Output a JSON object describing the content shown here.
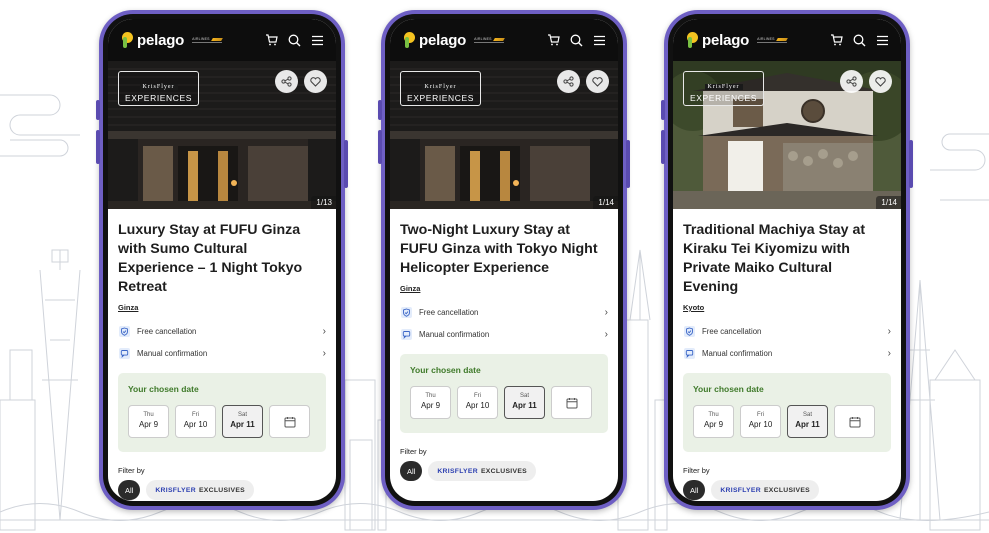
{
  "brand": {
    "name": "pelago",
    "airline_text": "AIRLINES",
    "experiences_small": "KrisFlyer",
    "experiences_big": "EXPERIENCES"
  },
  "colors": {
    "phone_frame": "#6e5fc4",
    "date_box_bg": "#eaf1e6",
    "date_title": "#3f7a2a",
    "krisflyer_blue": "#2c3fb1"
  },
  "icons": {
    "cart": "cart-icon",
    "search": "search-icon",
    "menu": "hamburger-menu-icon",
    "share": "share-icon",
    "wishlist": "heart-icon",
    "cancellation": "shield-check-icon",
    "confirmation": "chat-bubble-icon",
    "calendar": "calendar-icon"
  },
  "phones": [
    {
      "image_counter": "1/13",
      "title": "Luxury Stay at FUFU Ginza with Sumo Cultural Experience – 1 Night Tokyo Retreat",
      "location": "Ginza",
      "features": [
        {
          "label": "Free cancellation"
        },
        {
          "label": "Manual confirmation"
        }
      ],
      "date_title": "Your chosen date",
      "dates": [
        {
          "dow": "Thu",
          "date": "Apr 9",
          "selected": false
        },
        {
          "dow": "Fri",
          "date": "Apr 10",
          "selected": false
        },
        {
          "dow": "Sat",
          "date": "Apr 11",
          "selected": true
        }
      ],
      "filter_label": "Filter by",
      "chip_all": "All",
      "chip_kf_brand": "KRISFLYER",
      "chip_kf_rest": "EXCLUSIVES"
    },
    {
      "image_counter": "1/14",
      "title": "Two-Night Luxury Stay at FUFU Ginza with Tokyo Night Helicopter Experience",
      "location": "Ginza",
      "features": [
        {
          "label": "Free cancellation"
        },
        {
          "label": "Manual confirmation"
        }
      ],
      "date_title": "Your chosen date",
      "dates": [
        {
          "dow": "Thu",
          "date": "Apr 9",
          "selected": false
        },
        {
          "dow": "Fri",
          "date": "Apr 10",
          "selected": false
        },
        {
          "dow": "Sat",
          "date": "Apr 11",
          "selected": true
        }
      ],
      "filter_label": "Filter by",
      "chip_all": "All",
      "chip_kf_brand": "KRISFLYER",
      "chip_kf_rest": "EXCLUSIVES"
    },
    {
      "image_counter": "1/14",
      "title": "Traditional Machiya Stay at Kiraku Tei Kiyomizu with Private Maiko Cultural Evening",
      "location": "Kyoto",
      "features": [
        {
          "label": "Free cancellation"
        },
        {
          "label": "Manual confirmation"
        }
      ],
      "date_title": "Your chosen date",
      "dates": [
        {
          "dow": "Thu",
          "date": "Apr 9",
          "selected": false
        },
        {
          "dow": "Fri",
          "date": "Apr 10",
          "selected": false
        },
        {
          "dow": "Sat",
          "date": "Apr 11",
          "selected": true
        }
      ],
      "filter_label": "Filter by",
      "chip_all": "All",
      "chip_kf_brand": "KRISFLYER",
      "chip_kf_rest": "EXCLUSIVES"
    }
  ]
}
